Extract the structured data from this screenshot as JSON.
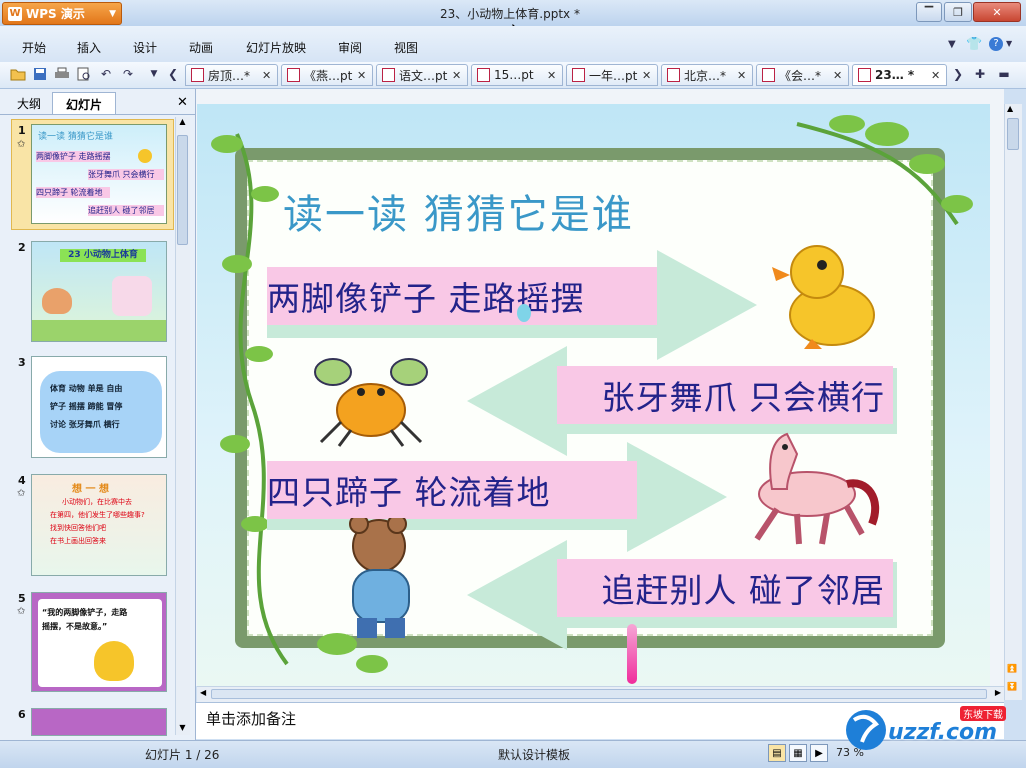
{
  "app": {
    "name": "WPS 演示",
    "logo_letter": "W"
  },
  "window": {
    "title": "23、小动物上体育.pptx *"
  },
  "menu": [
    "开始",
    "插入",
    "设计",
    "动画",
    "幻灯片放映",
    "审阅",
    "视图"
  ],
  "tabs": [
    {
      "label": "房顶…*"
    },
    {
      "label": "《燕…pt"
    },
    {
      "label": "语文…pt"
    },
    {
      "label": "15…pt"
    },
    {
      "label": "一年…pt"
    },
    {
      "label": "北京…*"
    },
    {
      "label": "《会…*"
    },
    {
      "label": "23… *"
    }
  ],
  "panel": {
    "outline_tab": "大纲",
    "slides_tab": "幻灯片"
  },
  "thumbs": {
    "t1": {
      "title": "读一读 猜猜它是谁",
      "l1": "两脚像铲子 走路摇摆",
      "l2": "张牙舞爪 只会横行",
      "l3": "四只蹄子 轮流着地",
      "l4": "追赶别人 碰了邻居"
    },
    "t2": {
      "title": "23 小动物上体育"
    },
    "t3": {
      "r1": "体育  动物  单是  自由",
      "r2": "铲子  摇摆  蹄能  冒停",
      "r3": "讨论  张牙舞爪  横行"
    },
    "t4": {
      "title": "想 一 想",
      "l1": "小动物们，在比赛中去",
      "l2": "在第四，他们发生了哪些趣事?",
      "l3": "找到快回答他们吧",
      "l4": "在书上画出回答来"
    },
    "t5": {
      "l1": "“我的两脚像铲子，走路",
      "l2": "摇摆，不是故意。”"
    }
  },
  "slide": {
    "heading": "读一读  猜猜它是谁",
    "lines": [
      "两脚像铲子  走路摇摆",
      "张牙舞爪  只会横行",
      "四只蹄子  轮流着地",
      "追赶别人  碰了邻居"
    ]
  },
  "notes_placeholder": "单击添加备注",
  "status": {
    "slide_counter": "幻灯片 1 / 26",
    "template": "默认设计模板",
    "zoom": "73 %"
  },
  "watermark": {
    "brand": "uzzf.com",
    "tag": "东坡下载"
  }
}
